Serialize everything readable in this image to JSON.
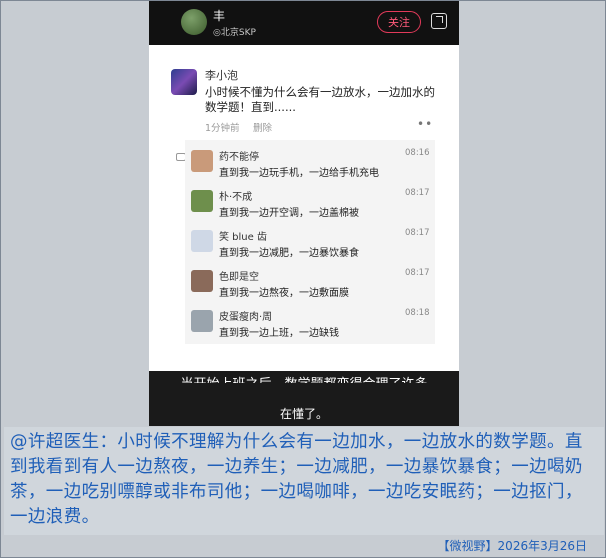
{
  "profile": {
    "name": "丰",
    "location": "◎北京SKP",
    "follow_label": "关注"
  },
  "post": {
    "author": "李小泡",
    "text": "小时候不懂为什么会有一边放水，一边加水的数学题！直到......",
    "time": "1分钟前",
    "delete_label": "删除",
    "more": "••"
  },
  "comments": [
    {
      "name": "药不能停",
      "time": "08:16",
      "text": "直到我一边玩手机，一边给手机充电",
      "avatar_color": "#c99a7a"
    },
    {
      "name": "朴·不成",
      "time": "08:17",
      "text": "直到我一边开空调，一边盖棉被",
      "avatar_color": "#6e8f4c"
    },
    {
      "name": "笑 blue 齿",
      "time": "08:17",
      "text": "直到我一边减肥，一边暴饮暴食",
      "avatar_color": "#cfd8e6"
    },
    {
      "name": "色即是空",
      "time": "08:17",
      "text": "直到我一边熬夜，一边敷面膜",
      "avatar_color": "#8a6a5a"
    },
    {
      "name": "皮蛋瘦肉·周",
      "time": "08:18",
      "text": "直到我一边上班，一边缺钱",
      "avatar_color": "#9aa4ad"
    }
  ],
  "video": {
    "subtitle_1": "当开始上班之后，数学题都变得合理了许多",
    "subtitle_2": "在懂了。"
  },
  "caption": "@许超医生：小时候不理解为什么会有一边加水，一边放水的数学题。直到我看到有人一边熬夜，一边养生；一边减肥，一边暴饮暴食；一边喝奶茶，一边吃别嘌醇或非布司他；一边喝咖啡，一边吃安眠药；一边抠门，一边浪费。",
  "footer": "【微视野】2026年3月26日"
}
